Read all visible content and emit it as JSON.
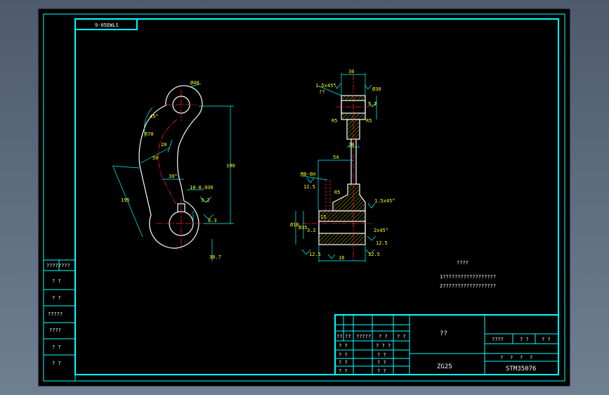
{
  "drawing": {
    "code_box": "9-05EWLS",
    "model_label": "ZG25",
    "drawing_number": "STM35076",
    "title_question": "??",
    "notes": {
      "heading": "????",
      "line1": "1??????????????????",
      "line2": "2??????????????????"
    },
    "left_strip": [
      "????????",
      "? ?",
      "? ?",
      "?????",
      "????",
      "? ?",
      "? ?"
    ],
    "title_block_cells": {
      "row1": [
        "??",
        "??",
        "?????",
        "? ?",
        "? ?"
      ],
      "rowA": [
        "? ?",
        "? ? ?"
      ],
      "rowB": [
        "? ?",
        "? ?"
      ],
      "rowC": [
        "? ?",
        "? ?"
      ],
      "rowD": [
        "? ?",
        "? ?"
      ],
      "right_top": [
        "????",
        "? ?",
        "? ?"
      ],
      "right_mid": [
        "?",
        "?",
        "?",
        "?"
      ]
    },
    "front_view_dims": {
      "d40": "Ø40",
      "a45": "45°",
      "r70": "R70",
      "w20a": "20",
      "w50": "50",
      "a30": "30°",
      "len195": "195",
      "h190": "190",
      "kw": "10-0.036",
      "ra32a": "3.2",
      "ra63": "6.3",
      "n307": "30.7"
    },
    "side_view_dims": {
      "top30": "30",
      "chamfer_top": "1.5x45°",
      "q_top": "??",
      "d30": "Ø30",
      "ra32_top": "3.2",
      "r5_left": "R5",
      "r5_right": "R5",
      "w20b": "20",
      "w54": "54",
      "m8": "M8-6H",
      "ra125a": "12.5",
      "r5_low": "R5",
      "chamfer_low": "1.5x45°",
      "d18": "Ø18",
      "d35": "Ø35",
      "h15": "15",
      "ra32_left": "3.2",
      "chamfer_bot": "2x45°",
      "ra125b": "12.5",
      "ra125c": "12.5",
      "ra125d": "12.5",
      "w16": "16"
    }
  }
}
